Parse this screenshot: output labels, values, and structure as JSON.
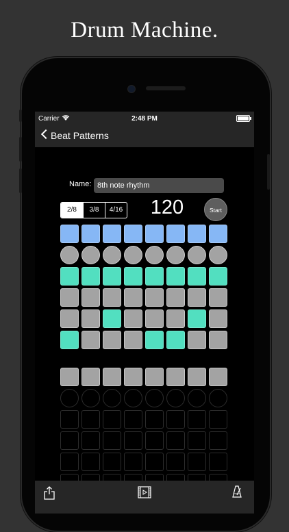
{
  "headline": "Drum Machine.",
  "status": {
    "carrier": "Carrier",
    "time": "2:48 PM"
  },
  "nav": {
    "back_label": "Beat Patterns"
  },
  "pattern": {
    "name_label": "Name:",
    "name_value": "8th note rhythm"
  },
  "signatures": {
    "options": [
      "2/8",
      "3/8",
      "4/16"
    ],
    "selected": "2/8"
  },
  "tempo": "120",
  "start_label": "Start",
  "colors": {
    "blue": "#86b7f5",
    "teal": "#52dfc0",
    "gray": "#a3a3a3",
    "bar": "#262626"
  },
  "grid_top": [
    [
      "blue",
      "blue",
      "blue",
      "blue",
      "blue",
      "blue",
      "blue",
      "blue"
    ],
    [
      "gray-circle",
      "gray-circle",
      "gray-circle",
      "gray-circle",
      "gray-circle",
      "gray-circle",
      "gray-circle",
      "gray-circle"
    ],
    [
      "teal",
      "teal",
      "teal",
      "teal",
      "teal",
      "teal",
      "teal",
      "teal"
    ],
    [
      "gray",
      "gray",
      "gray",
      "gray",
      "gray",
      "gray",
      "gray",
      "gray"
    ],
    [
      "gray",
      "gray",
      "teal",
      "gray",
      "gray",
      "gray",
      "teal",
      "gray"
    ],
    [
      "teal",
      "gray",
      "gray",
      "gray",
      "teal",
      "teal",
      "gray",
      "gray"
    ]
  ],
  "grid_bottom": [
    [
      "gray",
      "gray",
      "gray",
      "gray",
      "gray",
      "gray",
      "gray",
      "gray"
    ],
    [
      "empty-circle",
      "empty-circle",
      "empty-circle",
      "empty-circle",
      "empty-circle",
      "empty-circle",
      "empty-circle",
      "empty-circle"
    ],
    [
      "empty",
      "empty",
      "empty",
      "empty",
      "empty",
      "empty",
      "empty",
      "empty"
    ],
    [
      "empty",
      "empty",
      "empty",
      "empty",
      "empty",
      "empty",
      "empty",
      "empty"
    ],
    [
      "empty",
      "empty",
      "empty",
      "empty",
      "empty",
      "empty",
      "empty",
      "empty"
    ],
    [
      "empty",
      "empty",
      "empty",
      "empty",
      "empty",
      "empty",
      "empty",
      "empty"
    ]
  ],
  "toolbar": {
    "icons": [
      "share-icon",
      "video-icon",
      "metronome-icon"
    ]
  }
}
